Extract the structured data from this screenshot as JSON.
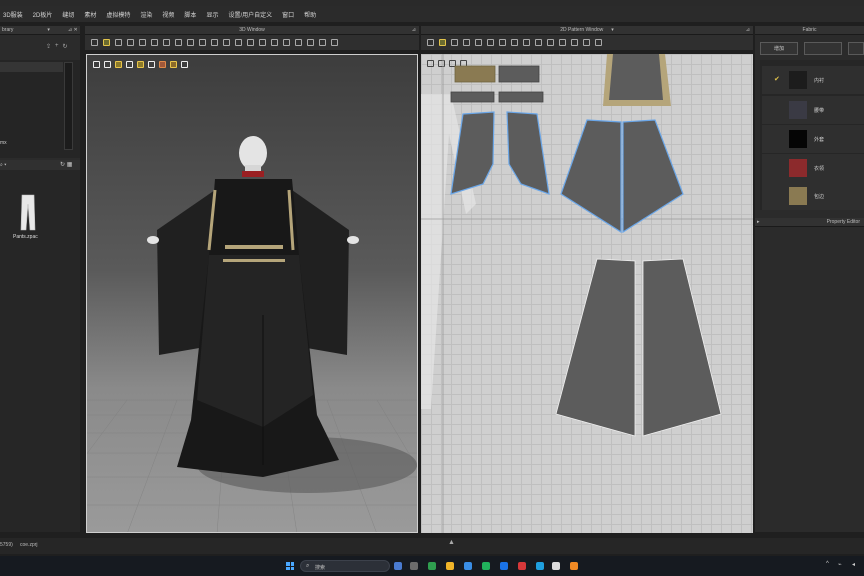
{
  "menu": [
    "3D服装",
    "2D板片",
    "缝纫",
    "素材",
    "虚拟模特",
    "渲染",
    "视频",
    "脚本",
    "显示",
    "设置/用户自定义",
    "窗口",
    "帮助"
  ],
  "library": {
    "title": "brary",
    "item_suffix": "mx",
    "file_name": "Pants.zpac"
  },
  "window3d": {
    "title": "3D Window"
  },
  "window2d": {
    "title": "2D Pattern Window"
  },
  "fabric": {
    "title": "Fabric",
    "buttons": [
      "增加",
      "",
      ""
    ],
    "items": [
      {
        "name": "内衬",
        "color": "#1c1c1c",
        "checked": true
      },
      {
        "name": "腰带",
        "color": "#3a3a44",
        "checked": false
      },
      {
        "name": "外套",
        "color": "#050505",
        "checked": false
      },
      {
        "name": "衣领",
        "color": "#8c2a2c",
        "checked": false
      },
      {
        "name": "包边",
        "color": "#8a7a52",
        "checked": false
      }
    ]
  },
  "property_editor": {
    "title": "Property Editor"
  },
  "status": {
    "left_text": "5759)",
    "file_text": "coe.zprj"
  },
  "taskbar": {
    "search_placeholder": "搜索"
  },
  "colors": {
    "accent_selected": "#e1c34b",
    "pattern_fill": "#5c5c5c",
    "pattern_outline_selected": "#6aa6e8",
    "trim": "#b5a57a"
  }
}
